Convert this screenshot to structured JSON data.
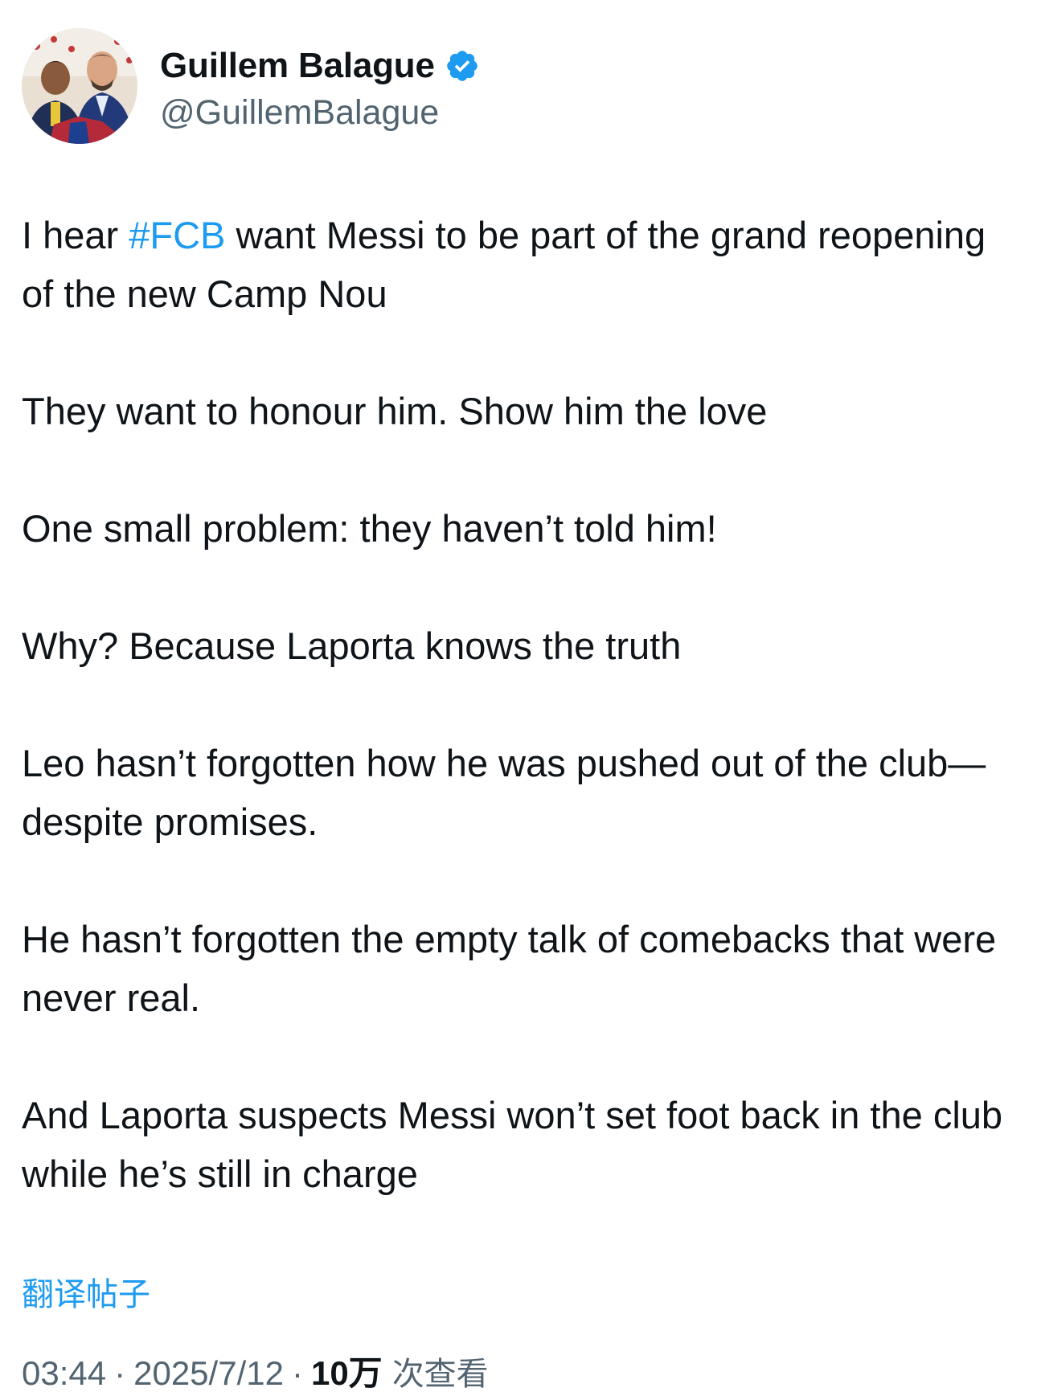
{
  "author": {
    "display_name": "Guillem Balague",
    "handle": "@GuillemBalague",
    "verified": true,
    "verified_color": "#1d9bf0"
  },
  "tweet": {
    "paragraphs": [
      {
        "segments": [
          {
            "text": "I hear ",
            "hashtag": false
          },
          {
            "text": "#FCB",
            "hashtag": true
          },
          {
            "text": " want Messi to be part of the grand reopening of the new Camp Nou",
            "hashtag": false
          }
        ]
      },
      {
        "segments": [
          {
            "text": "They want to honour him. Show him the love",
            "hashtag": false
          }
        ]
      },
      {
        "segments": [
          {
            "text": "One small problem: they haven’t told him!",
            "hashtag": false
          }
        ]
      },
      {
        "segments": [
          {
            "text": "Why? Because Laporta knows the truth",
            "hashtag": false
          }
        ]
      },
      {
        "segments": [
          {
            "text": "Leo hasn’t forgotten how he was pushed out of the club—despite promises.",
            "hashtag": false
          }
        ]
      },
      {
        "segments": [
          {
            "text": "He hasn’t forgotten the empty talk of comebacks that were never real.",
            "hashtag": false
          }
        ]
      },
      {
        "segments": [
          {
            "text": "And Laporta suspects Messi won’t set foot back in the club while he’s still in charge",
            "hashtag": false
          }
        ]
      }
    ],
    "translate_label": "翻译帖子"
  },
  "meta": {
    "time": "03:44",
    "separator": "·",
    "date": "2025/7/12",
    "views_count": "10万",
    "views_label": "次查看"
  },
  "colors": {
    "text": "#0f1419",
    "secondary": "#536471",
    "accent": "#1d9bf0"
  },
  "icons": {
    "verified": "verified-badge-icon"
  }
}
